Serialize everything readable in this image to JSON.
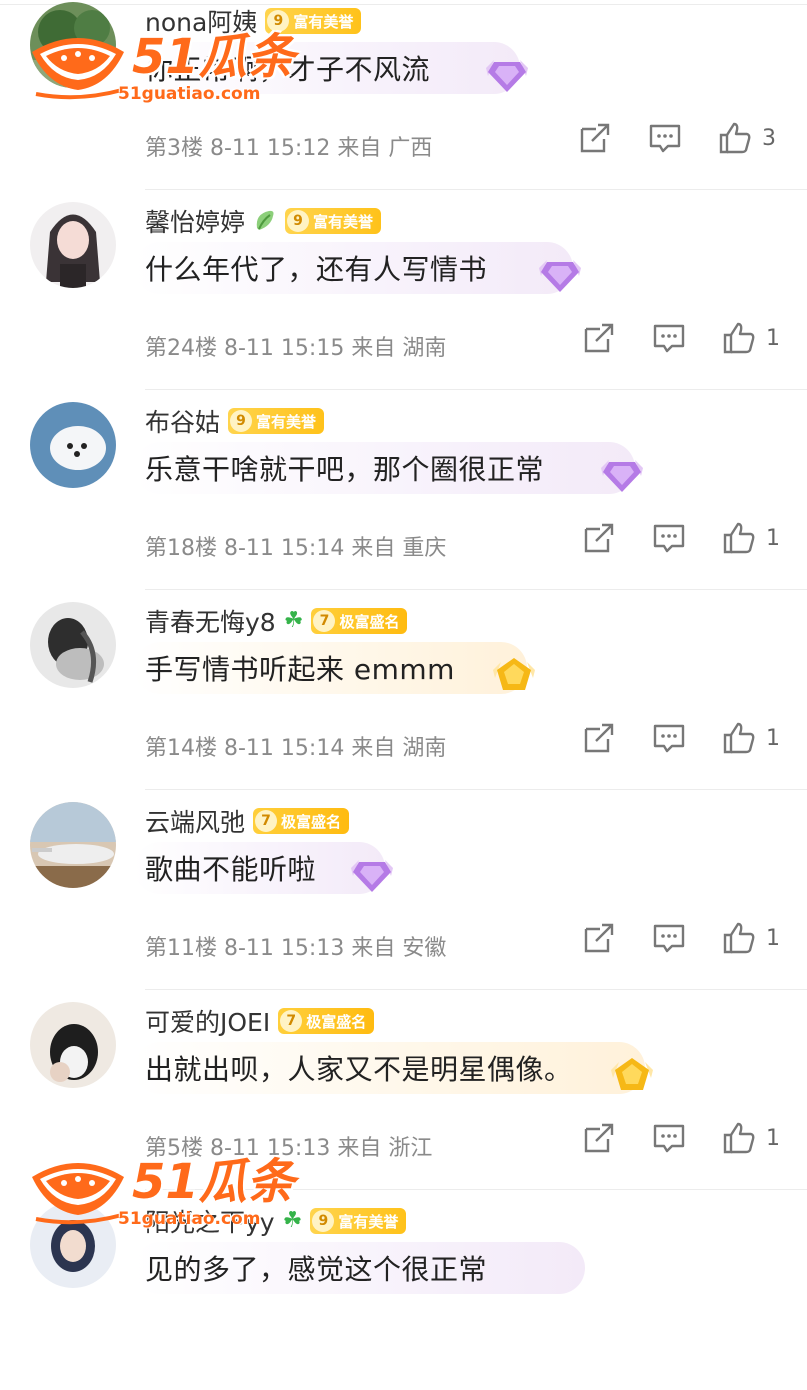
{
  "watermark": {
    "title": "51瓜条",
    "url": "51guatiao.com"
  },
  "comments": [
    {
      "username": "nona阿姨",
      "level": "9",
      "badge": "富有美誉",
      "extra_icon": "",
      "text": "你正常啊，才子不风流",
      "floor": "第3楼",
      "date": "8-11 15:12",
      "from": "来自",
      "region": "广西",
      "likes": "3"
    },
    {
      "username": "馨怡婷婷",
      "level": "9",
      "badge": "富有美誉",
      "extra_icon": "leaf-icon",
      "text": "什么年代了，还有人写情书",
      "floor": "第24楼",
      "date": "8-11 15:15",
      "from": "来自",
      "region": "湖南",
      "likes": "1"
    },
    {
      "username": "布谷姑",
      "level": "9",
      "badge": "富有美誉",
      "extra_icon": "",
      "text": "乐意干啥就干吧，那个圈很正常",
      "floor": "第18楼",
      "date": "8-11 15:14",
      "from": "来自",
      "region": "重庆",
      "likes": "1"
    },
    {
      "username": "青春无悔y8",
      "level": "7",
      "badge": "极富盛名",
      "extra_icon": "clover-icon",
      "text": "手写情书听起来 emmm",
      "floor": "第14楼",
      "date": "8-11 15:14",
      "from": "来自",
      "region": "湖南",
      "likes": "1"
    },
    {
      "username": "云端风弛",
      "level": "7",
      "badge": "极富盛名",
      "extra_icon": "",
      "text": "歌曲不能听啦",
      "floor": "第11楼",
      "date": "8-11 15:13",
      "from": "来自",
      "region": "安徽",
      "likes": "1"
    },
    {
      "username": "可爱的JOEI",
      "level": "7",
      "badge": "极富盛名",
      "extra_icon": "",
      "text": "出就出呗，人家又不是明星偶像。",
      "floor": "第5楼",
      "date": "8-11 15:13",
      "from": "来自",
      "region": "浙江",
      "likes": "1"
    },
    {
      "username": "阳光之下yy",
      "level": "9",
      "badge": "富有美誉",
      "extra_icon": "clover-icon",
      "text": "见的多了，感觉这个很正常",
      "floor": "",
      "date": "",
      "from": "",
      "region": "",
      "likes": ""
    }
  ],
  "colors": {
    "brand_orange": "#ff6a1a",
    "badge_gold": "#ffc21a",
    "meta_gray": "#8a8a8a"
  }
}
